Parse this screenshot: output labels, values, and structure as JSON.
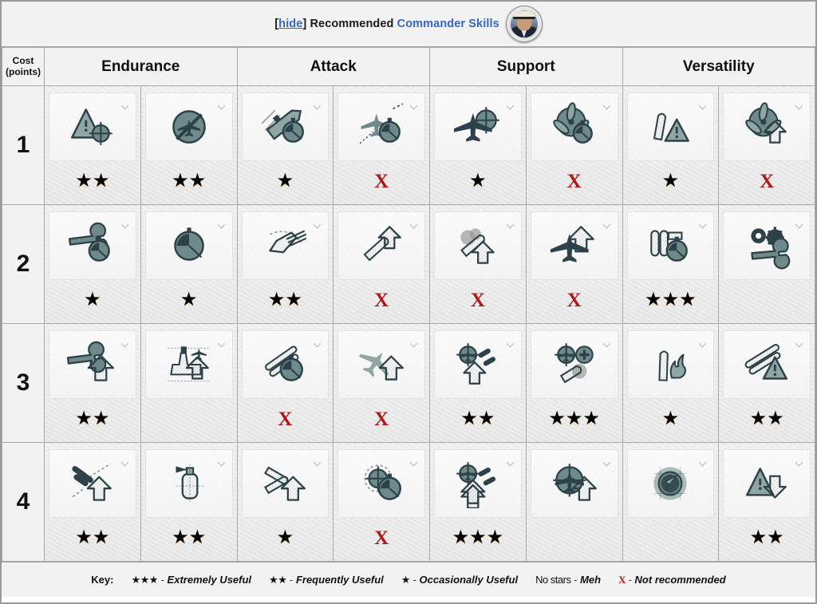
{
  "header": {
    "hide_bracket_open": "[",
    "hide_label": "hide",
    "hide_bracket_close": "]",
    "title_prefix": "Recommended",
    "title_link": "Commander Skills",
    "avatar_name": "commander-portrait",
    "link_color": "#3366cc"
  },
  "table": {
    "cost_header_line1": "Cost",
    "cost_header_line2": "(points)",
    "categories": [
      "Endurance",
      "Attack",
      "Support",
      "Versatility"
    ],
    "rows": [
      {
        "cost": "1",
        "cells": [
          {
            "icon": "warning-triangle-target-icon",
            "rating": "★★",
            "rating_type": "stars"
          },
          {
            "icon": "no-plane-circle-icon",
            "rating": "★★",
            "rating_type": "stars"
          },
          {
            "icon": "ship-speed-stopwatch-icon",
            "rating": "★",
            "rating_type": "stars"
          },
          {
            "icon": "plane-stopwatch-icon",
            "rating": "X",
            "rating_type": "x"
          },
          {
            "icon": "plane-target-icon",
            "rating": "★",
            "rating_type": "stars"
          },
          {
            "icon": "propeller-stopwatch-icon",
            "rating": "X",
            "rating_type": "x"
          },
          {
            "icon": "torpedo-warning-icon",
            "rating": "★",
            "rating_type": "stars"
          },
          {
            "icon": "propeller-uparrow-icon",
            "rating": "X",
            "rating_type": "x"
          }
        ]
      },
      {
        "cost": "2",
        "cells": [
          {
            "icon": "wrench-stopwatch-icon",
            "rating": "★",
            "rating_type": "stars"
          },
          {
            "icon": "stopwatch-icon",
            "rating": "★",
            "rating_type": "stars"
          },
          {
            "icon": "aa-gun-arc-icon",
            "rating": "★★",
            "rating_type": "stars"
          },
          {
            "icon": "torpedo-uparrow-icon",
            "rating": "X",
            "rating_type": "x"
          },
          {
            "icon": "smoke-shell-uparrow-icon",
            "rating": "X",
            "rating_type": "x"
          },
          {
            "icon": "plane-uparrow-icon",
            "rating": "X",
            "rating_type": "x"
          },
          {
            "icon": "shells-stopwatch-icon",
            "rating": "★★★",
            "rating_type": "stars"
          },
          {
            "icon": "gears-wrench-icon",
            "rating": "",
            "rating_type": "none"
          }
        ]
      },
      {
        "cost": "3",
        "cells": [
          {
            "icon": "wrench-uparrow-icon",
            "rating": "★★",
            "rating_type": "stars"
          },
          {
            "icon": "carrier-uparrow-icon",
            "rating": "",
            "rating_type": "none"
          },
          {
            "icon": "gun-barrels-stopwatch-icon",
            "rating": "X",
            "rating_type": "x"
          },
          {
            "icon": "plane-dive-uparrow-icon",
            "rating": "X",
            "rating_type": "x"
          },
          {
            "icon": "plane-target-shells-uparrow-icon",
            "rating": "★★",
            "rating_type": "stars"
          },
          {
            "icon": "plane-target-plus-icon",
            "rating": "★★★",
            "rating_type": "stars"
          },
          {
            "icon": "torpedo-fire-icon",
            "rating": "★",
            "rating_type": "stars"
          },
          {
            "icon": "gun-barrels-warning-icon",
            "rating": "★★",
            "rating_type": "stars"
          }
        ]
      },
      {
        "cost": "4",
        "cells": [
          {
            "icon": "shells-salvo-uparrow-icon",
            "rating": "★★",
            "rating_type": "stars"
          },
          {
            "icon": "fire-extinguisher-icon",
            "rating": "★★",
            "rating_type": "stars"
          },
          {
            "icon": "torpedoes-uparrow-icon",
            "rating": "★",
            "rating_type": "stars"
          },
          {
            "icon": "radar-stopwatch-icon",
            "rating": "X",
            "rating_type": "x"
          },
          {
            "icon": "plane-target-shells-uparrow2-icon",
            "rating": "★★★",
            "rating_type": "stars"
          },
          {
            "icon": "plane-crosshair-uparrow-icon",
            "rating": "",
            "rating_type": "none"
          },
          {
            "icon": "sonar-compass-icon",
            "rating": "",
            "rating_type": "none"
          },
          {
            "icon": "warning-downarrow-icon",
            "rating": "★★",
            "rating_type": "stars"
          }
        ]
      }
    ]
  },
  "key": {
    "label": "Key:",
    "items": [
      {
        "symbol": "★★★",
        "type": "stars",
        "dash": "-",
        "desc": "Extremely Useful"
      },
      {
        "symbol": "★★",
        "type": "stars",
        "dash": "-",
        "desc": "Frequently Useful"
      },
      {
        "symbol": "★",
        "type": "stars",
        "dash": "-",
        "desc": "Occasionally Useful"
      },
      {
        "symbol": "No stars",
        "type": "text",
        "dash": "-",
        "desc": "Meh"
      },
      {
        "symbol": "X",
        "type": "x",
        "dash": "-",
        "desc": "Not recommended"
      }
    ]
  }
}
